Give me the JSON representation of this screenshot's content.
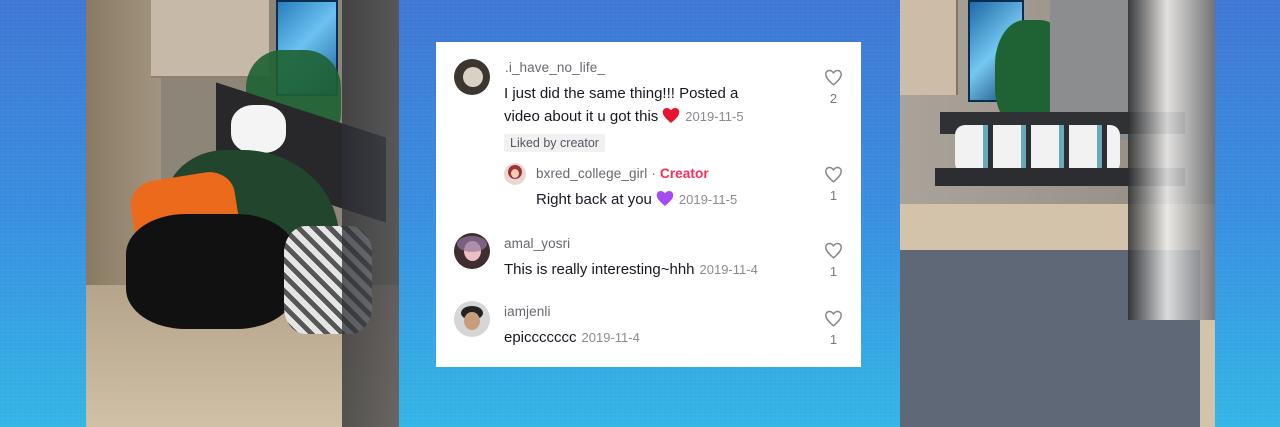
{
  "comments": [
    {
      "username": ".i_have_no_life_",
      "text": "I just did the same thing!!! Posted a video about it u got this",
      "emoji": "red-heart",
      "date": "2019-11-5",
      "badge": "Liked by creator",
      "likes": "2"
    },
    {
      "username": "bxred_college_girl",
      "creator_label": "Creator",
      "text": "Right back at you",
      "emoji": "purple-heart",
      "date": "2019-11-5",
      "likes": "1",
      "is_reply": true
    },
    {
      "username": "amal_yosri",
      "text": "This is really interesting~hhh",
      "date": "2019-11-4",
      "likes": "1"
    },
    {
      "username": "iamjenli",
      "text": "epiccccccc",
      "date": "2019-11-4",
      "likes": "1"
    }
  ],
  "colors": {
    "background_top": "#3f78d6",
    "background_bottom": "#34b6e7",
    "creator_accent": "#fe2c55",
    "red_heart": "#e6142d",
    "purple_heart": "#a64bf4"
  },
  "icons": {
    "like": "heart-outline-icon",
    "red_emoji": "red-heart-emoji",
    "purple_emoji": "purple-heart-emoji"
  }
}
